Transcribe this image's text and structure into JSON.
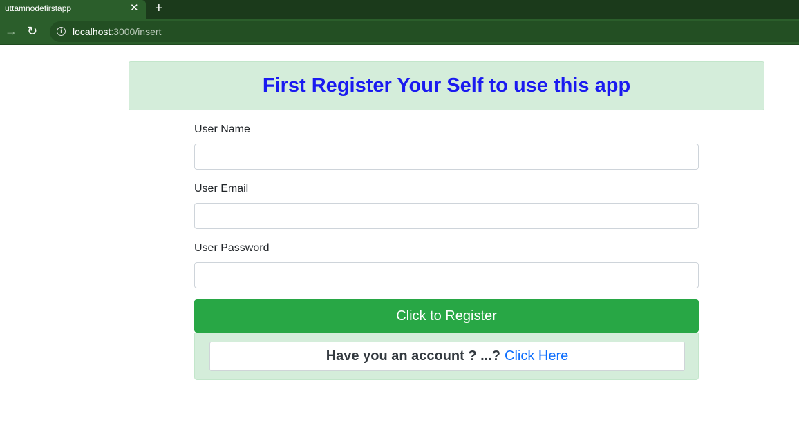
{
  "browser": {
    "tab_title": "uttamnodefirstapp",
    "close_glyph": "✕",
    "new_tab_glyph": "+",
    "forward_glyph": "→",
    "reload_glyph": "↻",
    "url_host": "localhost",
    "url_rest": ":3000/insert"
  },
  "page": {
    "heading": "First Register Your Self to use this app",
    "fields": {
      "name_label": "User Name",
      "email_label": "User Email",
      "password_label": "User Password",
      "name_value": "",
      "email_value": "",
      "password_value": ""
    },
    "register_button": "Click to Register",
    "account_question": "Have you an account ? ...?",
    "account_link": "Click Here"
  },
  "colors": {
    "banner_bg": "#d4edda",
    "heading": "#1a1af0",
    "register_button": "#28a745",
    "link": "#0d6efd",
    "browser_frame": "#2b5e2b"
  }
}
